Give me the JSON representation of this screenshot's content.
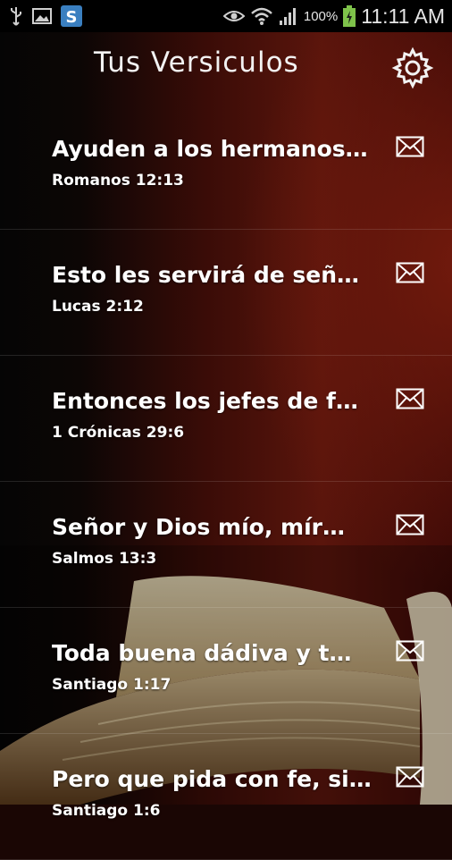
{
  "status_bar": {
    "battery_percent": "100%",
    "time": "11:11 AM",
    "icons": [
      "usb-icon",
      "image-icon",
      "app-s-icon",
      "eye-icon",
      "wifi-icon",
      "signal-icon",
      "battery-charging-icon"
    ]
  },
  "header": {
    "title": "Tus Versiculos",
    "settings_icon": "gear-icon"
  },
  "verses": [
    {
      "text": "Ayuden a los hermanos…",
      "reference": "Romanos 12:13",
      "icon": "envelope-icon"
    },
    {
      "text": "Esto les servirá de señ…",
      "reference": "Lucas 2:12",
      "icon": "envelope-icon"
    },
    {
      "text": "Entonces los jefes de f…",
      "reference": "1 Crónicas 29:6",
      "icon": "envelope-icon"
    },
    {
      "text": "Señor  y Dios mío,   mír…",
      "reference": "Salmos 13:3",
      "icon": "envelope-icon"
    },
    {
      "text": "Toda buena dádiva y t…",
      "reference": "Santiago 1:17",
      "icon": "envelope-icon"
    },
    {
      "text": "Pero que pida con fe, si…",
      "reference": "Santiago 1:6",
      "icon": "envelope-icon"
    }
  ],
  "colors": {
    "background_dark": "#050505",
    "background_red": "#5a150c",
    "text": "#ffffff"
  }
}
